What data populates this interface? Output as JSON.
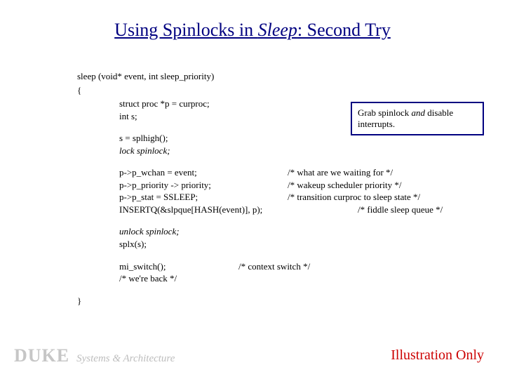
{
  "title_prefix": "Using Spinlocks in ",
  "title_em": "Sleep",
  "title_suffix": ": Second Try",
  "sig": "sleep (void* event, int sleep_priority)",
  "brace_open": "{",
  "brace_close": "}",
  "decl1": "struct proc *p = curproc;",
  "decl2": "int s;",
  "lock1": "s = splhigh();",
  "lock2": "lock spinlock;",
  "body1_l": "p->p_wchan = event;",
  "body1_c": "/* what are we waiting for */",
  "body2_l": "p->p_priority -> priority;",
  "body2_c": "/* wakeup scheduler priority */",
  "body3_l": "p->p_stat = SSLEEP;",
  "body3_c": "/* transition curproc to sleep state */",
  "body4_l": "INSERTQ(&slpque[HASH(event)], p);",
  "body4_c": "/* fiddle sleep queue */",
  "unlock1": "unlock spinlock;",
  "unlock2": "splx(s);",
  "switch_l": "mi_switch();",
  "switch_c": "/* context switch */",
  "back": "/* we're back */",
  "callout_pre": "Grab spinlock ",
  "callout_and": "and",
  "callout_post": " disable interrupts.",
  "duke": "DUKE",
  "sysarch": "Systems & Architecture",
  "illus": "Illustration Only"
}
